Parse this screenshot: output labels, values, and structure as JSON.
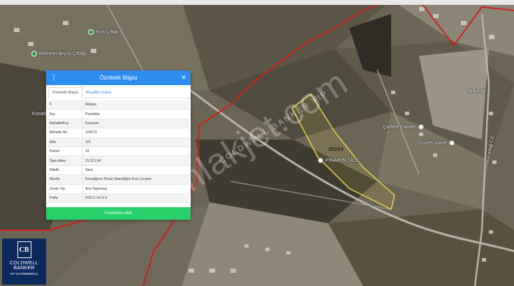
{
  "popup": {
    "title": "Öznitelik Bilgisi",
    "menu_icon": "kebab-menu-icon",
    "close_icon": "close-icon",
    "tabs": [
      {
        "label": "Öznitelik Bilgisi",
        "active": true
      },
      {
        "label": "Bina/Bb Listesi",
        "active": false
      }
    ],
    "rows": [
      {
        "key": "İl",
        "value": "Ankara"
      },
      {
        "key": "İlçe",
        "value": "Pursaklar"
      },
      {
        "key": "Mahalle/Koy",
        "value": "Kusucan"
      },
      {
        "key": "Mahalle No",
        "value": "124073"
      },
      {
        "key": "Ada",
        "value": "101"
      },
      {
        "key": "Parsel",
        "value": "14"
      },
      {
        "key": "Tapu Alanı",
        "value": "31.371,64"
      },
      {
        "key": "Nitelik",
        "value": "Tarla"
      },
      {
        "key": "Mevkii",
        "value": "Kocadğının Pınarı Namıdiğeri Kuru Çeşme"
      },
      {
        "key": "Zemin Tip",
        "value": "Ana Taşınmaz"
      },
      {
        "key": "Pafta",
        "value": "H29-C-14-D-3"
      }
    ],
    "favorite_button": "Favorilere ekle"
  },
  "map": {
    "places": [
      {
        "name": "Ruh Çiftlik",
        "dot": "green"
      },
      {
        "name": "Mehmet Bey'in Çiftliği",
        "dot": "green"
      },
      {
        "name": "Çarbek Garden",
        "dot": "white"
      },
      {
        "name": "Cunes home",
        "dot": "white"
      },
      {
        "name": "Parke Nr",
        "dot": "white"
      },
      {
        "name": "PINAR'IN SİCİL",
        "dot": "white"
      }
    ],
    "parcel_label": "101/14",
    "road_labels": [
      "Kocadağ",
      "Kocadağ Cd."
    ],
    "watermark": "emlakjet.com",
    "watermark_sub": "COLDWELL BANKER VIP"
  },
  "logo": {
    "mark": "CB",
    "line1": "COLDWELL",
    "line2": "BANKER",
    "line3": "VIP GAYRİMENKUL"
  },
  "colors": {
    "header": "#2d8cf0",
    "favorite": "#27d169",
    "boundary": "#d21f1f",
    "parcel": "#e8d24a"
  }
}
